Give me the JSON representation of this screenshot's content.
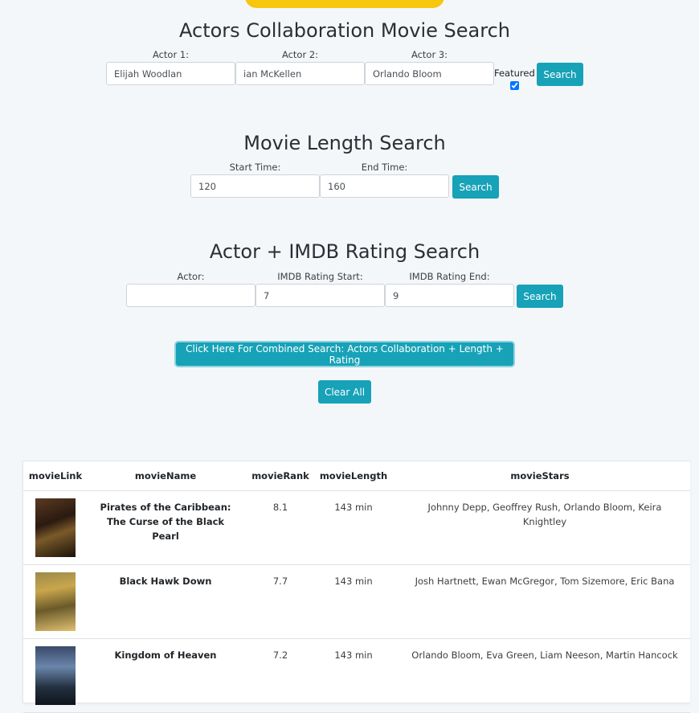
{
  "actors_search": {
    "title": "Actors Collaboration Movie Search",
    "actor1_label": "Actor 1:",
    "actor2_label": "Actor 2:",
    "actor3_label": "Actor 3:",
    "actor1_value": "Elijah Woodlan",
    "actor2_value": "ian McKellen",
    "actor3_value": "Orlando Bloom",
    "featured_label": "Featured",
    "featured_checked": true,
    "search_label": "Search"
  },
  "length_search": {
    "title": "Movie Length Search",
    "start_label": "Start Time:",
    "end_label": "End Time:",
    "start_value": "120",
    "end_value": "160",
    "search_label": "Search"
  },
  "rating_search": {
    "title": "Actor + IMDB Rating Search",
    "actor_label": "Actor:",
    "rating_start_label": "IMDB Rating Start:",
    "rating_end_label": "IMDB Rating End:",
    "actor_value": "",
    "rating_start_value": "7",
    "rating_end_value": "9",
    "search_label": "Search"
  },
  "combined_button_label": "Click Here For Combined Search: Actors Collaboration + Length + Rating",
  "clear_all_label": "Clear All",
  "results": {
    "columns": [
      "movieLink",
      "movieName",
      "movieRank",
      "movieLength",
      "movieStars"
    ],
    "rows": [
      {
        "name": "Pirates of the Caribbean: The Curse of the Black Pearl",
        "rank": "8.1",
        "length": "143 min",
        "stars": "Johnny Depp, Geoffrey Rush, Orlando Bloom, Keira Knightley"
      },
      {
        "name": "Black Hawk Down",
        "rank": "7.7",
        "length": "143 min",
        "stars": "Josh Hartnett, Ewan McGregor, Tom Sizemore, Eric Bana"
      },
      {
        "name": "Kingdom of Heaven",
        "rank": "7.2",
        "length": "143 min",
        "stars": "Orlando Bloom, Eva Green, Liam Neeson, Martin Hancock"
      }
    ]
  }
}
